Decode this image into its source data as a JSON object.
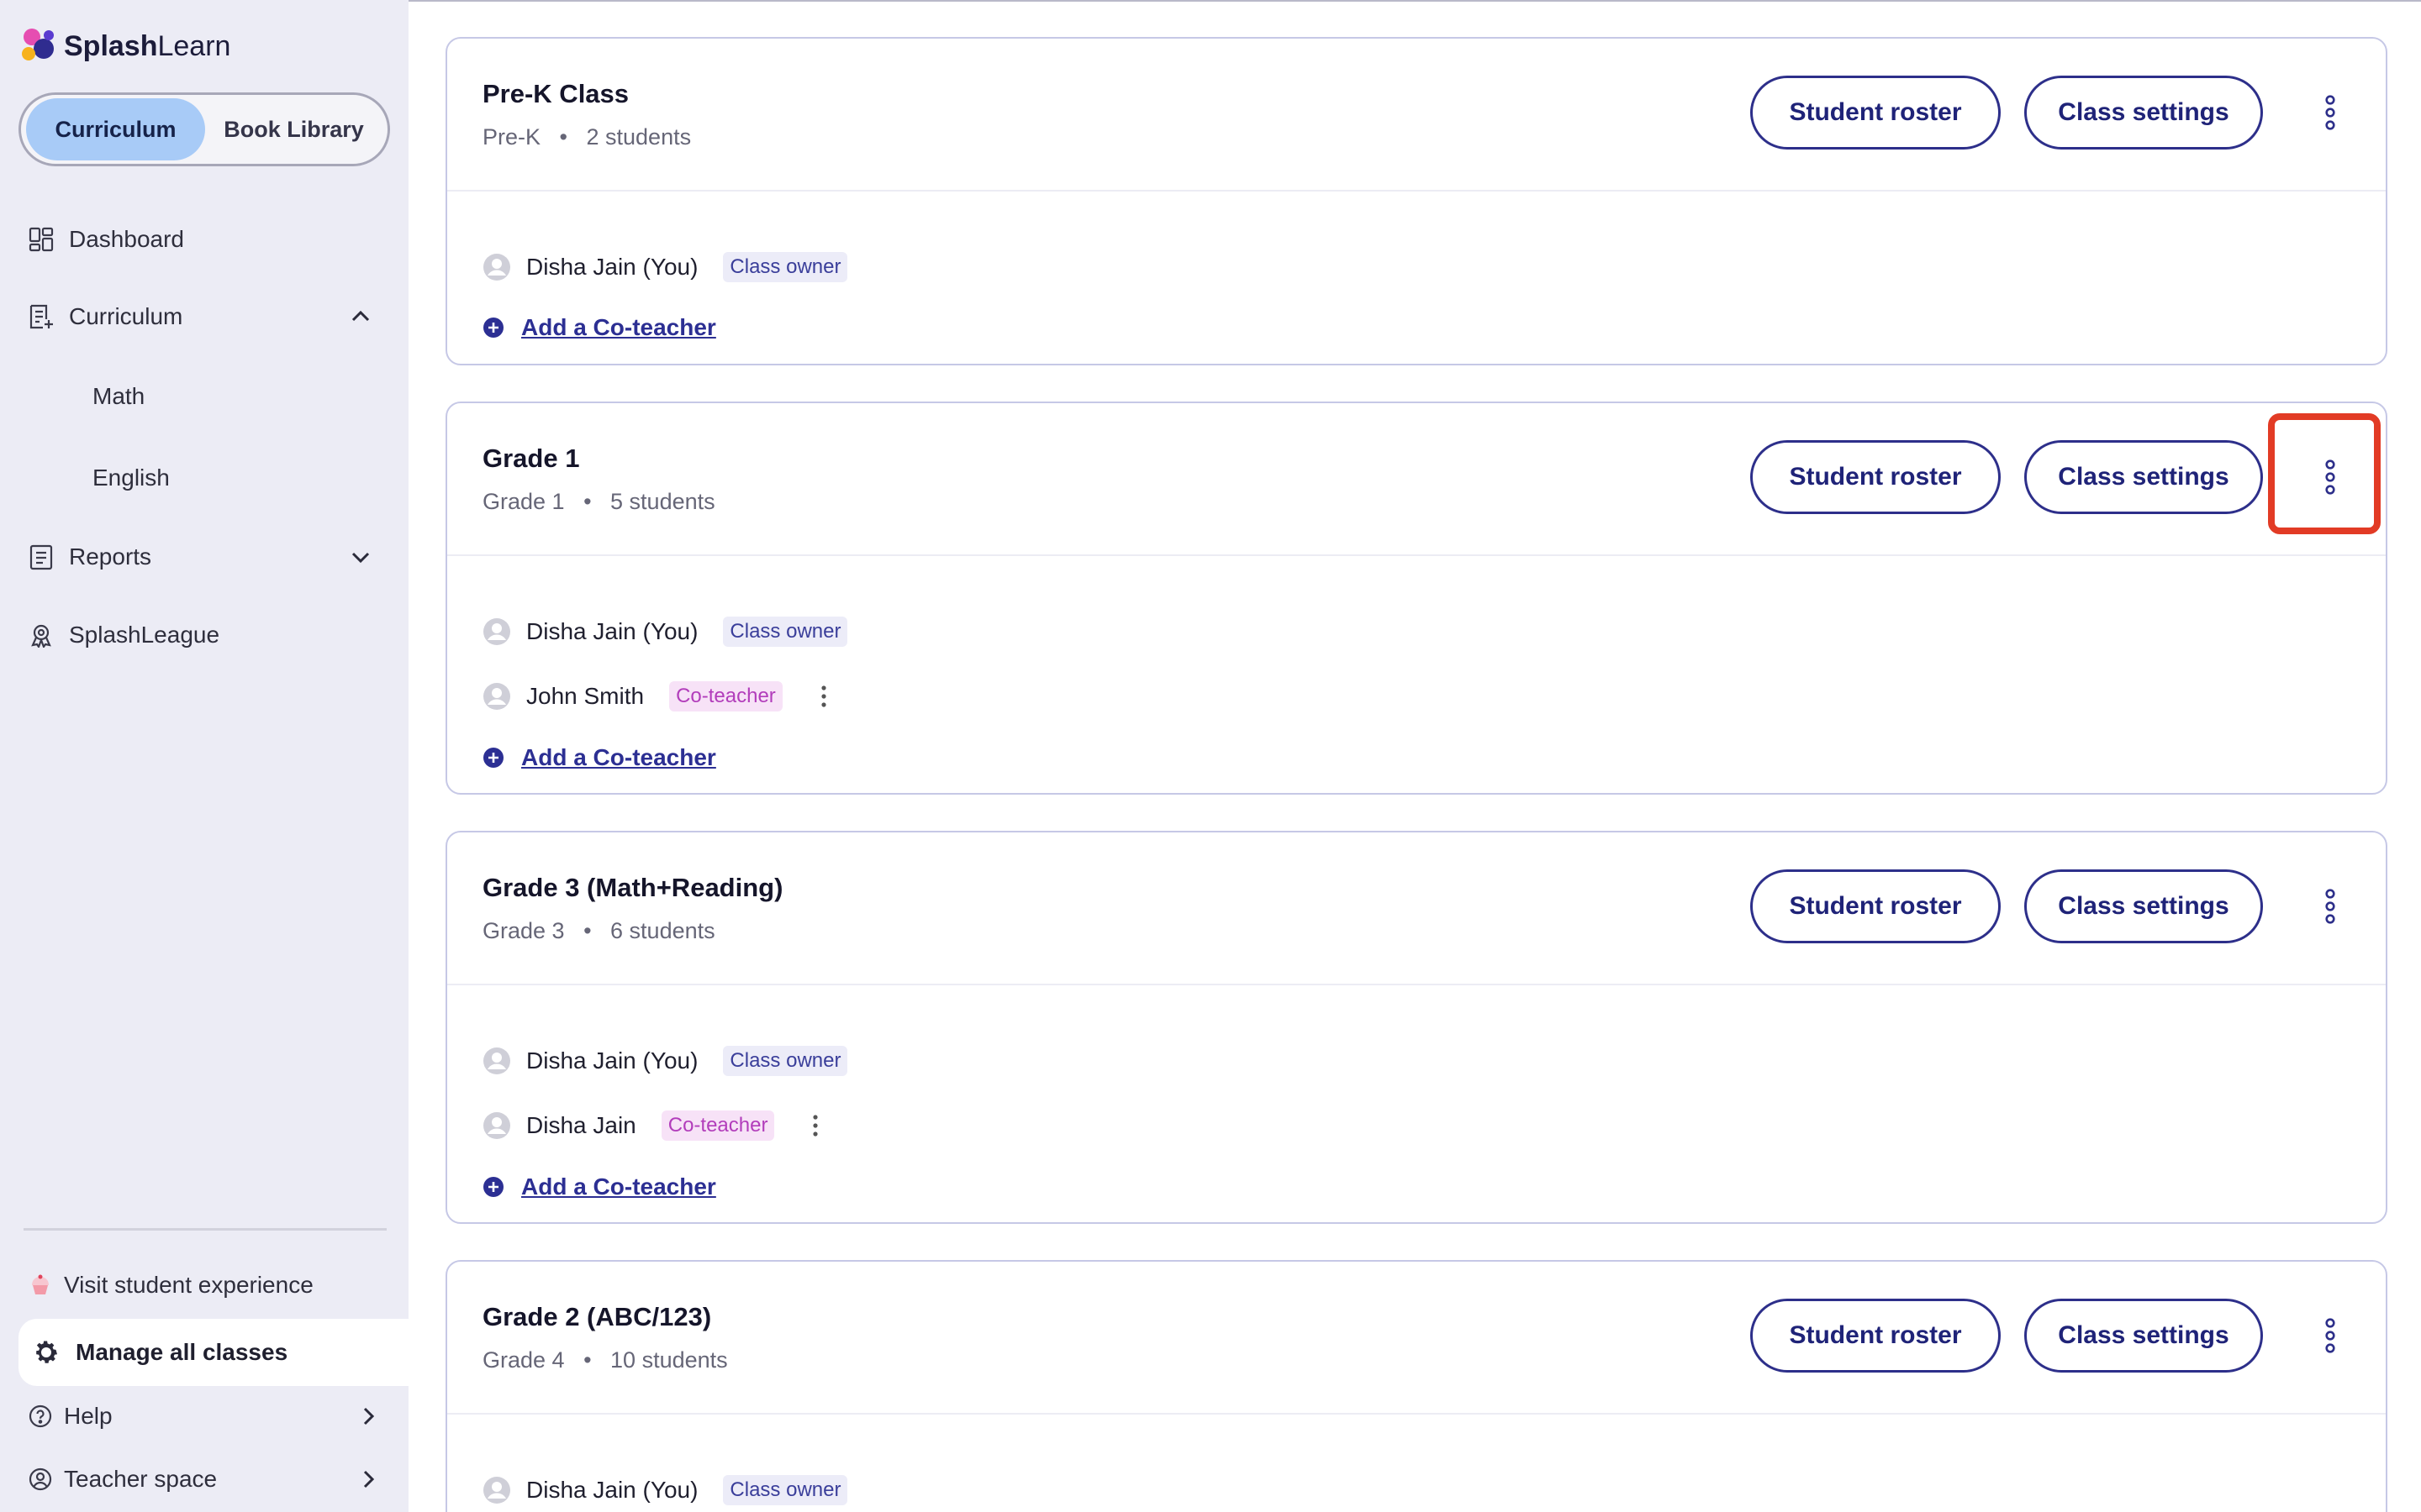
{
  "brand": {
    "name_bold": "Splash",
    "name_rest": "Learn"
  },
  "segment": {
    "active": "Curriculum",
    "inactive": "Book Library"
  },
  "nav": {
    "dashboard": "Dashboard",
    "curriculum": "Curriculum",
    "math": "Math",
    "english": "English",
    "reports": "Reports",
    "splashleague": "SplashLeague"
  },
  "bottom": {
    "visit": "Visit student experience",
    "manage": "Manage all classes",
    "help": "Help",
    "teacher": "Teacher space"
  },
  "buttons": {
    "roster": "Student roster",
    "settings": "Class settings",
    "add": "Add a Co-teacher"
  },
  "badges": {
    "owner": "Class owner",
    "co": "Co-teacher"
  },
  "classes": [
    {
      "title": "Pre-K Class",
      "grade": "Pre-K",
      "students": "2 students",
      "members": [
        {
          "name": "Disha Jain (You)",
          "role": "Class owner"
        }
      ]
    },
    {
      "title": "Grade 1",
      "grade": "Grade 1",
      "students": "5 students",
      "members": [
        {
          "name": "Disha Jain (You)",
          "role": "Class owner"
        },
        {
          "name": "John Smith",
          "role": "Co-teacher"
        }
      ]
    },
    {
      "title": "Grade 3 (Math+Reading)",
      "grade": "Grade 3",
      "students": "6 students",
      "members": [
        {
          "name": "Disha Jain (You)",
          "role": "Class owner"
        },
        {
          "name": "Disha Jain",
          "role": "Co-teacher"
        }
      ]
    },
    {
      "title": "Grade 2 (ABC/123)",
      "grade": "Grade 4",
      "students": "10 students",
      "members": [
        {
          "name": "Disha Jain (You)",
          "role": "Class owner"
        }
      ]
    }
  ],
  "colors": {
    "accent": "#2d2f8a",
    "highlight": "#e23b25",
    "sidebar": "#ececf5",
    "segment_active": "#a8cbf7"
  }
}
